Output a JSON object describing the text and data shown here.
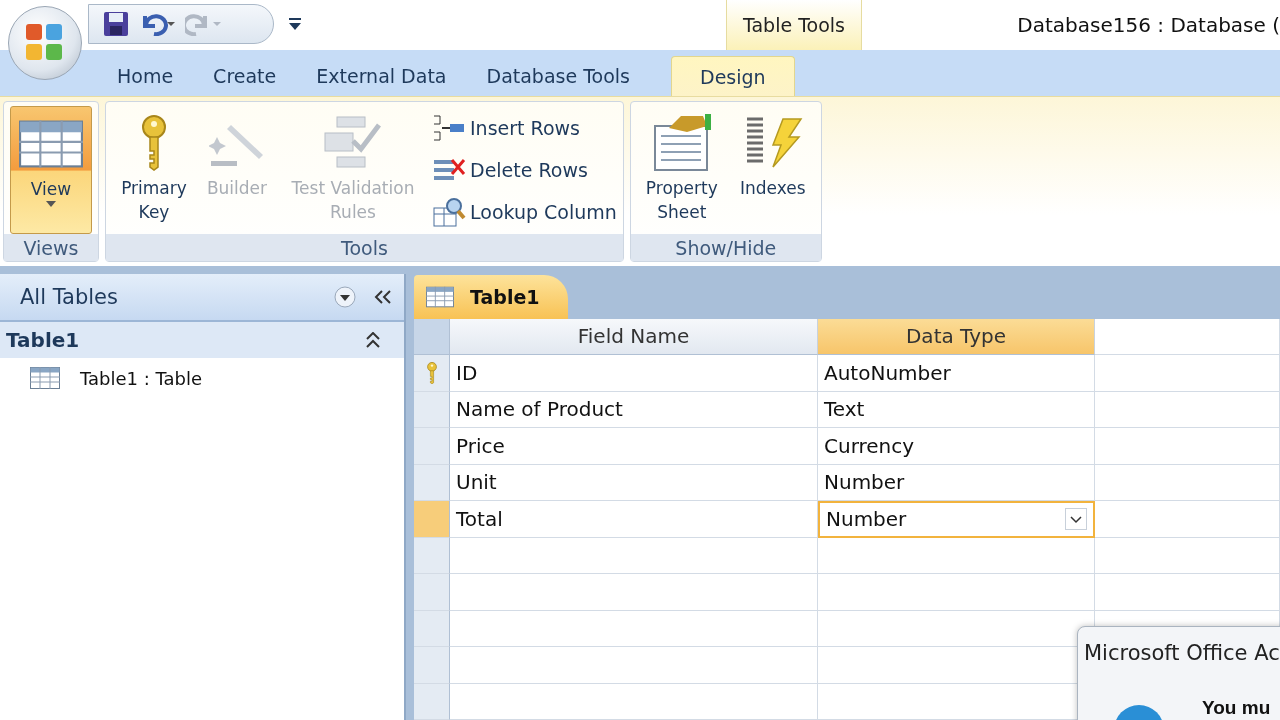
{
  "title_bar": {
    "contextual_group": "Table Tools",
    "window_title": "Database156 : Database ("
  },
  "tabs": [
    {
      "label": "Home",
      "selected": false
    },
    {
      "label": "Create",
      "selected": false
    },
    {
      "label": "External Data",
      "selected": false
    },
    {
      "label": "Database Tools",
      "selected": false
    },
    {
      "label": "Design",
      "selected": true
    }
  ],
  "ribbon_groups": [
    {
      "label": "Views",
      "buttons": [
        {
          "label": "View",
          "kind": "large",
          "active": true,
          "disabled": false
        }
      ]
    },
    {
      "label": "Tools",
      "buttons": [
        {
          "label": "Primary Key",
          "kind": "large",
          "active": false,
          "disabled": false
        },
        {
          "label": "Builder",
          "kind": "large",
          "active": false,
          "disabled": true
        },
        {
          "label": "Test Validation Rules",
          "kind": "large",
          "active": false,
          "disabled": true
        },
        {
          "label": "Insert Rows",
          "kind": "small",
          "active": false,
          "disabled": false
        },
        {
          "label": "Delete Rows",
          "kind": "small",
          "active": false,
          "disabled": false
        },
        {
          "label": "Lookup Column",
          "kind": "small",
          "active": false,
          "disabled": false
        }
      ]
    },
    {
      "label": "Show/Hide",
      "buttons": [
        {
          "label": "Property Sheet",
          "kind": "large",
          "active": false,
          "disabled": false
        },
        {
          "label": "Indexes",
          "kind": "large",
          "active": false,
          "disabled": false
        }
      ]
    }
  ],
  "nav_pane": {
    "title": "All Tables",
    "group": {
      "label": "Table1",
      "expanded": true,
      "items": [
        {
          "label": "Table1 : Table"
        }
      ]
    }
  },
  "document_tabs": [
    {
      "label": "Table1",
      "selected": true
    }
  ],
  "design_grid": {
    "columns": [
      {
        "label": "Field Name",
        "selected": false
      },
      {
        "label": "Data Type",
        "selected": true
      }
    ],
    "rows": [
      {
        "field_name": "ID",
        "data_type": "AutoNumber",
        "primary_key": true,
        "selected": false
      },
      {
        "field_name": "Name of Product",
        "data_type": "Text",
        "primary_key": false,
        "selected": false
      },
      {
        "field_name": "Price",
        "data_type": "Currency",
        "primary_key": false,
        "selected": false
      },
      {
        "field_name": "Unit",
        "data_type": "Number",
        "primary_key": false,
        "selected": false
      },
      {
        "field_name": "Total",
        "data_type": "Number",
        "primary_key": false,
        "selected": true
      }
    ]
  },
  "dialog": {
    "title": "Microsoft Office Ac",
    "message": "You mu"
  }
}
